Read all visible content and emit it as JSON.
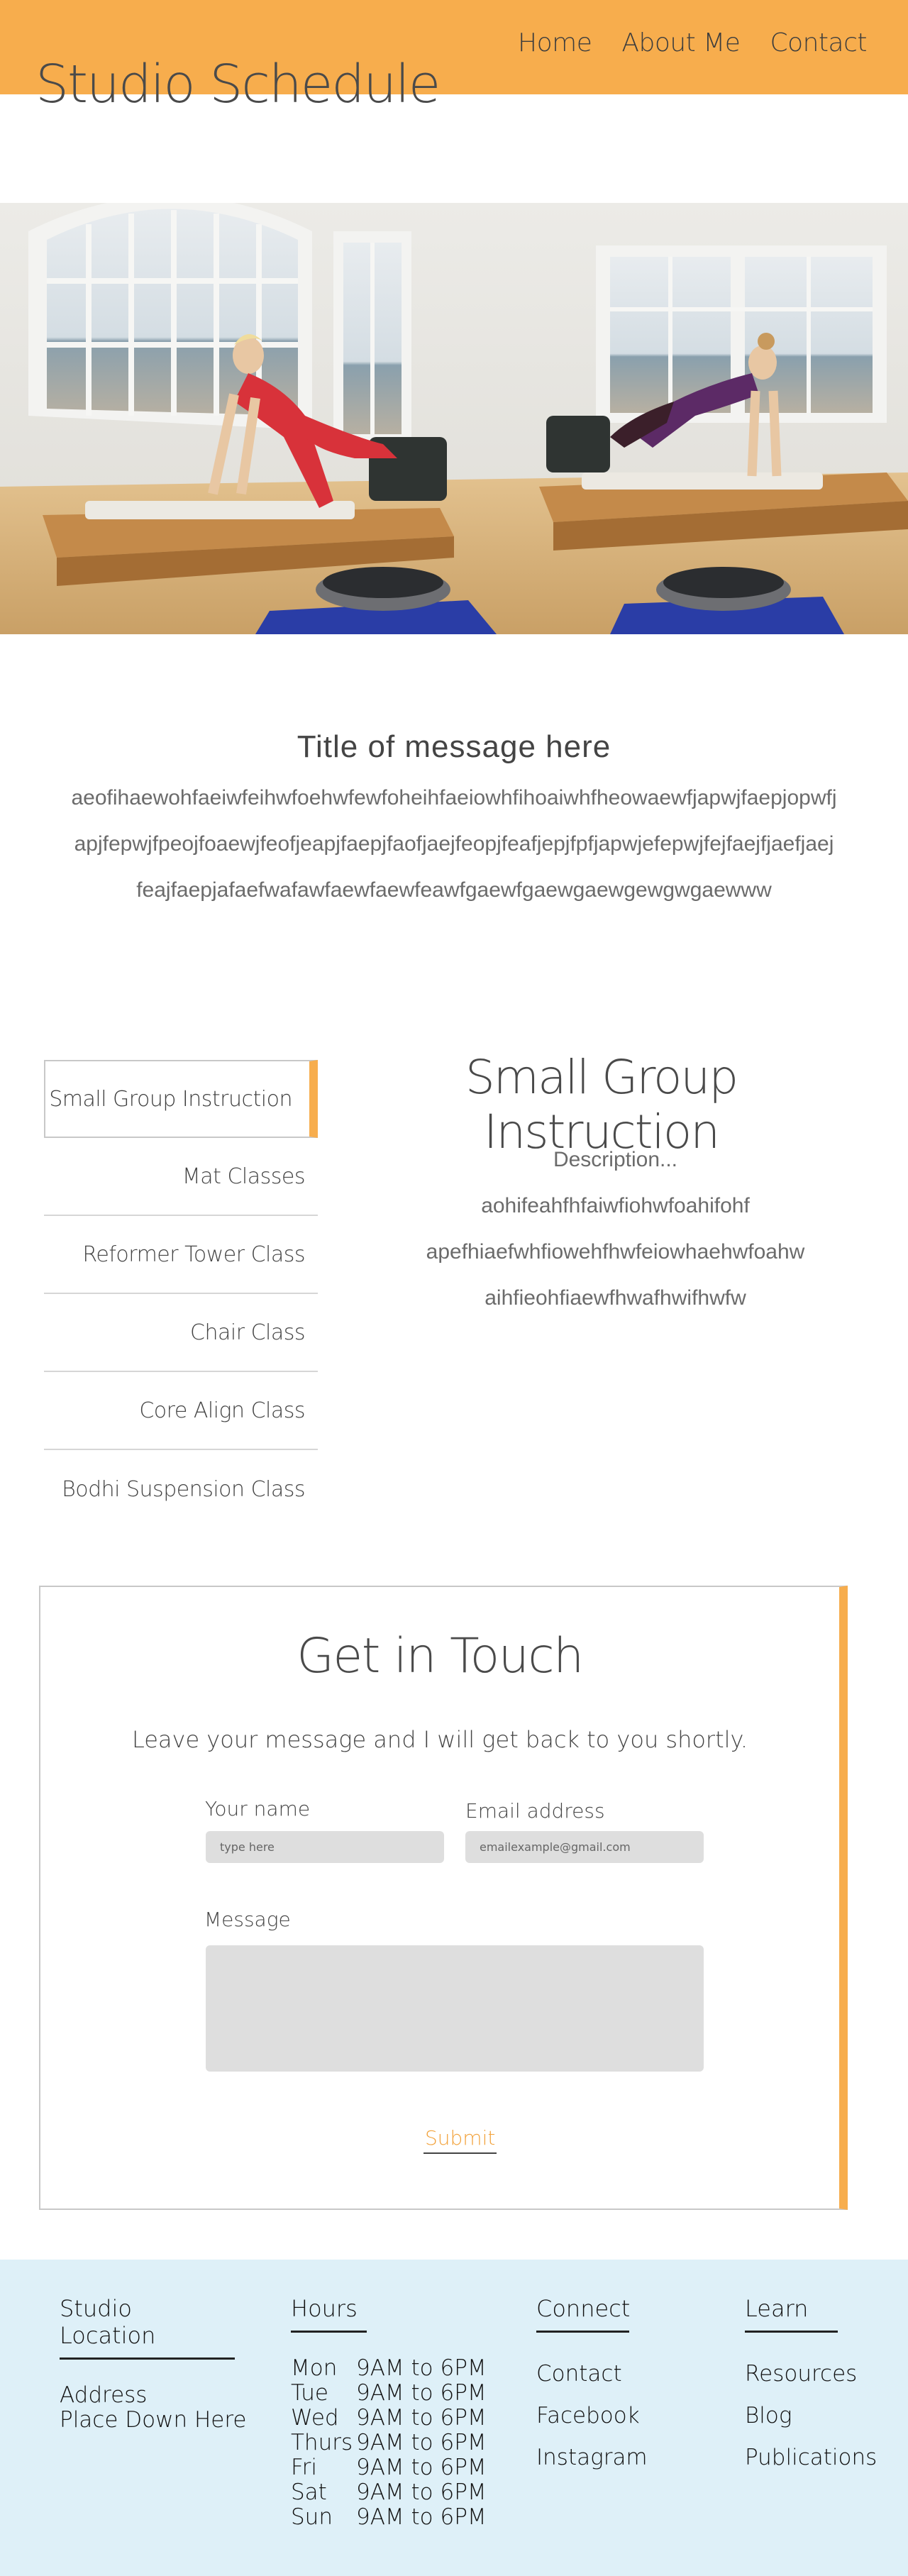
{
  "header": {
    "site_title": "Studio Schedule",
    "nav": [
      "Home",
      "About Me",
      "Contact"
    ],
    "bg_color": "#f7ad4d"
  },
  "message": {
    "title": "Title of message here",
    "lines": [
      "aeofihaewohfaeiwfeihwfoehwfewfoheihfaeiowhfihoaiwhfheowaewfjapwjfaepjopwfj",
      "apjfepwjfpeojfoaewjfeofjeapjfaepjfaofjaejfeopjfeafjepjfpfjapwjefepwjfejfaejfjaefjaej",
      "feajfaepjafaefwafawfaewfaewfeawfgaewfgaewgaewgewgwgaewww"
    ]
  },
  "classes": {
    "items": [
      "Small Group Instruction",
      "Mat Classes",
      "Reformer Tower Class",
      "Chair Class",
      "Core Align Class",
      "Bodhi Suspension Class"
    ],
    "active_index": 0,
    "detail": {
      "title": "Small Group Instruction",
      "lines": [
        "Description...",
        "aohifeahfhfaiwfiohwfoahifohf",
        "apefhiaefwhfiowehfhwfeiowhaehwfoahw",
        "aihfieohfiaewfhwafhwifhwfw"
      ]
    }
  },
  "contact": {
    "title": "Get in Touch",
    "subtitle": "Leave your message and I will get back to you shortly.",
    "name_label": "Your name",
    "name_placeholder": "type here",
    "email_label": "Email address",
    "email_placeholder": "emailexample@gmail.com",
    "message_label": "Message",
    "submit_label": "Submit"
  },
  "footer": {
    "location": {
      "heading": "Studio Location",
      "line1": "Address",
      "line2": "Place Down Here"
    },
    "hours": {
      "heading": "Hours",
      "rows": [
        {
          "day": "Mon",
          "time": "9AM to 6PM"
        },
        {
          "day": "Tue",
          "time": "9AM to 6PM"
        },
        {
          "day": "Wed",
          "time": "9AM to 6PM"
        },
        {
          "day": "Thurs",
          "time": "9AM to 6PM"
        },
        {
          "day": "Fri",
          "time": "9AM to 6PM"
        },
        {
          "day": "Sat",
          "time": "9AM to 6PM"
        },
        {
          "day": "Sun",
          "time": "9AM to 6PM"
        }
      ]
    },
    "connect": {
      "heading": "Connect",
      "links": [
        "Contact",
        "Facebook",
        "Instagram"
      ]
    },
    "learn": {
      "heading": "Learn",
      "links": [
        "Resources",
        "Blog",
        "Publications"
      ]
    },
    "bg_color": "#def0f8"
  }
}
